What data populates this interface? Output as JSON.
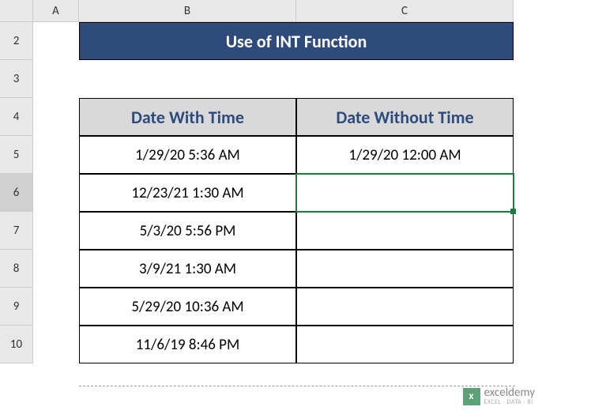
{
  "columns": [
    "A",
    "B",
    "C"
  ],
  "rows": [
    "2",
    "3",
    "4",
    "5",
    "6",
    "7",
    "8",
    "9",
    "10"
  ],
  "title": "Use of INT Function",
  "headers": {
    "col_b": "Date With Time",
    "col_c": "Date Without Time"
  },
  "data_b": [
    "1/29/20 5:36 AM",
    "12/23/21 1:30 AM",
    "5/3/20 5:56 PM",
    "3/9/21 1:30 AM",
    "5/29/20 10:36 AM",
    "11/6/19 8:46 PM"
  ],
  "data_c": [
    "1/29/20 12:00 AM",
    "",
    "",
    "",
    "",
    ""
  ],
  "selected_cell": "C6",
  "watermark": {
    "name": "exceldemy",
    "sub": "EXCEL · DATA · BI"
  }
}
